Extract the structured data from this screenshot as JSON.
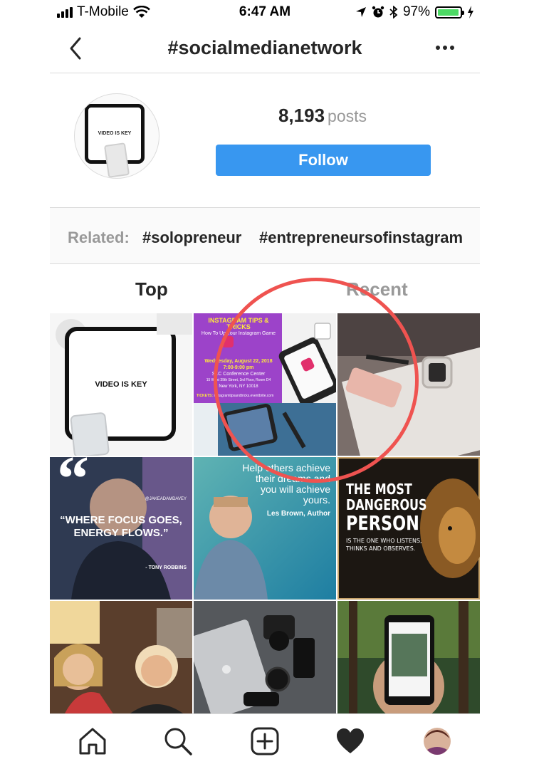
{
  "status_bar": {
    "carrier": "T-Mobile",
    "time": "6:47 AM",
    "battery": "97%",
    "battery_level": 0.97
  },
  "header": {
    "title": "#socialmedianetwork",
    "back_icon": "chevron-left-icon",
    "more_icon": "more-horizontal-icon"
  },
  "profile": {
    "avatar_text": "VIDEO IS KEY",
    "post_count": "8,193",
    "posts_label": "posts",
    "follow_label": "Follow"
  },
  "related": {
    "label": "Related:",
    "tags": [
      "#solopreneur",
      "#entrepreneursofinstagram"
    ]
  },
  "tabs": [
    {
      "label": "Top",
      "active": true
    },
    {
      "label": "Recent",
      "active": false
    }
  ],
  "posts": {
    "video_is_key": "VIDEO IS KEY",
    "tips": {
      "title": "INSTAGRAM TIPS & TRICKS",
      "subtitle": "How To Up Your Instagram Game",
      "date": "Wednesday, August 22, 2018",
      "time": "7:00-9:00 pm",
      "venue": "SLC Conference Center",
      "address": "15 West 39th Street, 3rd Floor, Room D4",
      "city": "New York, NY 10018",
      "tickets": "TICKETS:",
      "tickets_url": "instagramtipsandtricks.eventbrite.com"
    },
    "quote_handle": "@JAKEADAMDAVEY",
    "quote_text_1": "“WHERE FOCUS GOES,",
    "quote_text_2": "ENERGY FLOWS.”",
    "quote_author": "- TONY ROBBINS",
    "les_quote_1": "Help others achieve",
    "les_quote_2": "their dreams and",
    "les_quote_3": "you will achieve",
    "les_quote_4": "yours.",
    "les_author": "Les Brown, Author",
    "lion_1": "THE MOST",
    "lion_2": "DANGEROUS",
    "lion_3": "PERSON",
    "lion_4": "IS THE ONE WHO LISTENS,",
    "lion_5": "THINKS AND OBSERVES."
  },
  "nav": {
    "items": [
      "home-icon",
      "search-icon",
      "add-post-icon",
      "heart-icon",
      "profile-avatar"
    ]
  },
  "colors": {
    "accent": "#3897f0",
    "annotation": "#ef5350",
    "battery": "#4cd964"
  }
}
